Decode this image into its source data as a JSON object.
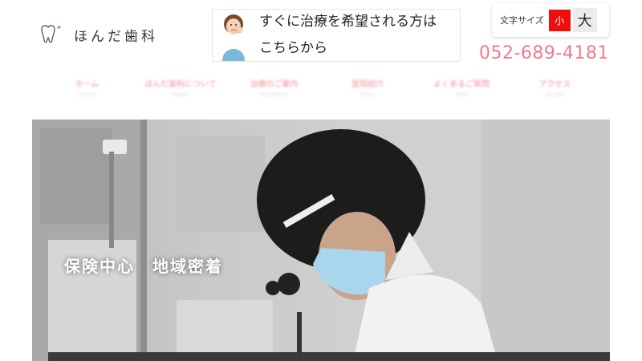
{
  "header": {
    "logo_text": "ほんだ歯科",
    "logo_icon": "tooth-icon",
    "cta_text_line1": "すぐに治療を希望される方は",
    "cta_text_line2": "こちらから",
    "phone": "052-689-4181"
  },
  "font_size_switcher": {
    "label": "文字サイズ",
    "small": "小",
    "large": "大",
    "selected": "小"
  },
  "nav": {
    "items": [
      {
        "label": "ホーム",
        "sub": "Home"
      },
      {
        "label": "ほんだ歯科について",
        "sub": "About"
      },
      {
        "label": "治療のご案内",
        "sub": "Treatment"
      },
      {
        "label": "医院紹介",
        "sub": "Clinic"
      },
      {
        "label": "よくあるご質問",
        "sub": "FAQ"
      },
      {
        "label": "アクセス",
        "sub": "Access"
      }
    ]
  },
  "hero": {
    "caption": "保険中心　地域密着"
  },
  "colors": {
    "accent_pink": "#ef7b8b",
    "small_button_red": "#f00d0d"
  }
}
